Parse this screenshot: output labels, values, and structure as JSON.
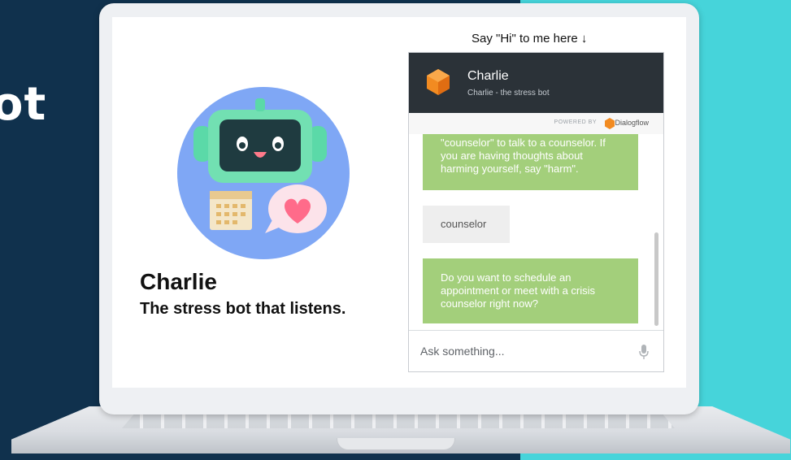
{
  "background": {
    "title_fragment": "ot",
    "colors": {
      "navy": "#10314d",
      "teal": "#46d4da"
    }
  },
  "bot": {
    "name": "Charlie",
    "tagline": "The stress bot that listens.",
    "avatar_icon": "robot-avatar-icon"
  },
  "chat": {
    "prompt": "Say \"Hi\" to me here ↓",
    "header": {
      "title": "Charlie",
      "subtitle": "Charlie - the stress bot"
    },
    "powered_by": "POWERED BY",
    "provider": "Dialogflow",
    "messages": [
      {
        "from": "bot",
        "lines": [
          "\"counselor\" to talk to a counselor. If",
          "you are having thoughts about",
          "harming yourself, say \"harm\"."
        ]
      },
      {
        "from": "user",
        "text": "counselor"
      },
      {
        "from": "bot",
        "lines": [
          "Do you want to schedule an",
          "appointment or meet with a crisis",
          "counselor right now?"
        ]
      }
    ],
    "input_placeholder": "Ask something...",
    "colors": {
      "header": "#2b3238",
      "bot_bubble": "#a3cf7b",
      "user_bubble": "#eeeeee"
    }
  }
}
